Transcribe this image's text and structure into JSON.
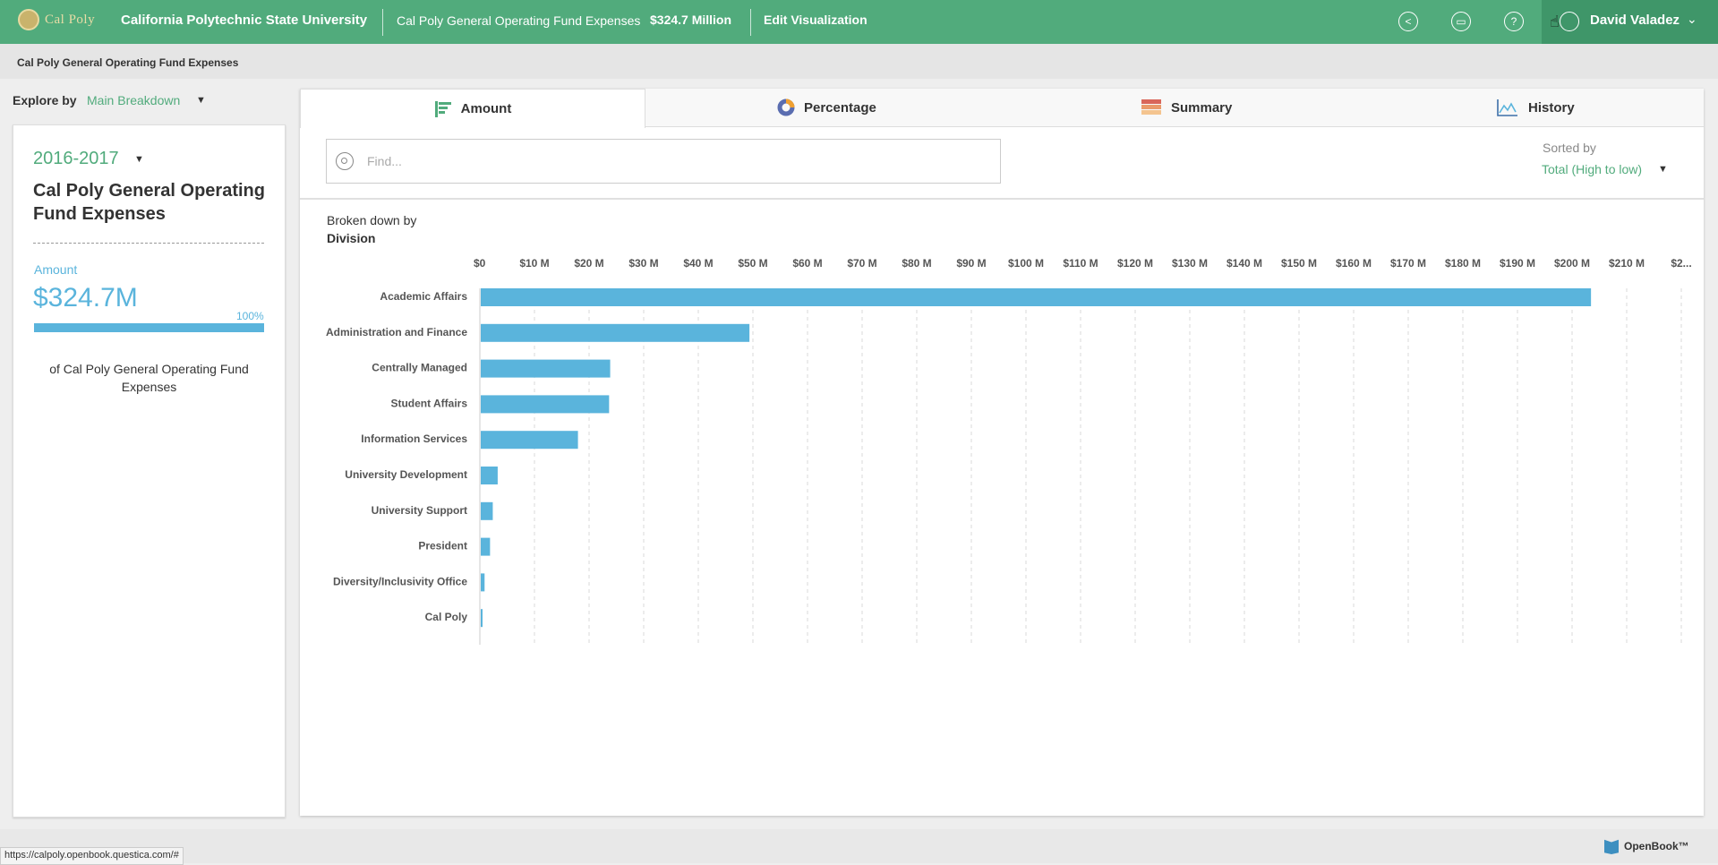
{
  "header": {
    "logo_text": "Cal Poly",
    "university": "California Polytechnic State University",
    "fund_name": "Cal Poly General Operating Fund Expenses",
    "fund_amount": "$324.7 Million",
    "edit_label": "Edit Visualization",
    "icons": [
      "share-icon",
      "comment-icon",
      "help-icon"
    ],
    "user_name": "David Valadez"
  },
  "breadcrumb": "Cal Poly General Operating Fund Expenses",
  "explore": {
    "label": "Explore by",
    "value": "Main Breakdown"
  },
  "summary": {
    "year": "2016-2017",
    "title": "Cal Poly General Operating Fund Expenses",
    "amount_label": "Amount",
    "amount_value": "$324.7M",
    "percent": "100%",
    "of_text": "of Cal Poly General Operating Fund Expenses"
  },
  "tabs": [
    {
      "label": "Amount",
      "icon": "bar-chart-icon",
      "active": true
    },
    {
      "label": "Percentage",
      "icon": "donut-icon",
      "active": false
    },
    {
      "label": "Summary",
      "icon": "stacked-icon",
      "active": false
    },
    {
      "label": "History",
      "icon": "line-chart-icon",
      "active": false
    }
  ],
  "search": {
    "placeholder": "Find..."
  },
  "sort": {
    "label": "Sorted by",
    "value": "Total (High to low)"
  },
  "breakdown": {
    "label": "Broken down by",
    "value": "Division"
  },
  "chart_data": {
    "type": "bar",
    "orientation": "horizontal",
    "categories": [
      "Academic Affairs",
      "Administration and Finance",
      "Centrally Managed",
      "Student Affairs",
      "Information Services",
      "University Development",
      "University Support",
      "President",
      "Diversity/Inclusivity Office",
      "Cal Poly"
    ],
    "values": [
      203.3,
      49.2,
      23.7,
      23.5,
      17.8,
      3.1,
      2.2,
      1.7,
      0.7,
      0.3
    ],
    "tick_labels": [
      "$0",
      "$10 M",
      "$20 M",
      "$30 M",
      "$40 M",
      "$50 M",
      "$60 M",
      "$70 M",
      "$80 M",
      "$90 M",
      "$100 M",
      "$110 M",
      "$120 M",
      "$130 M",
      "$140 M",
      "$150 M",
      "$160 M",
      "$170 M",
      "$180 M",
      "$190 M",
      "$200 M",
      "$210 M",
      "$2..."
    ],
    "xlim": [
      0,
      220
    ],
    "bar_color": "#5ab4dc",
    "grid": "vertical dashed"
  },
  "footer": {
    "status_url": "https://calpoly.openbook.questica.com/#",
    "brand": "OpenBook™"
  }
}
